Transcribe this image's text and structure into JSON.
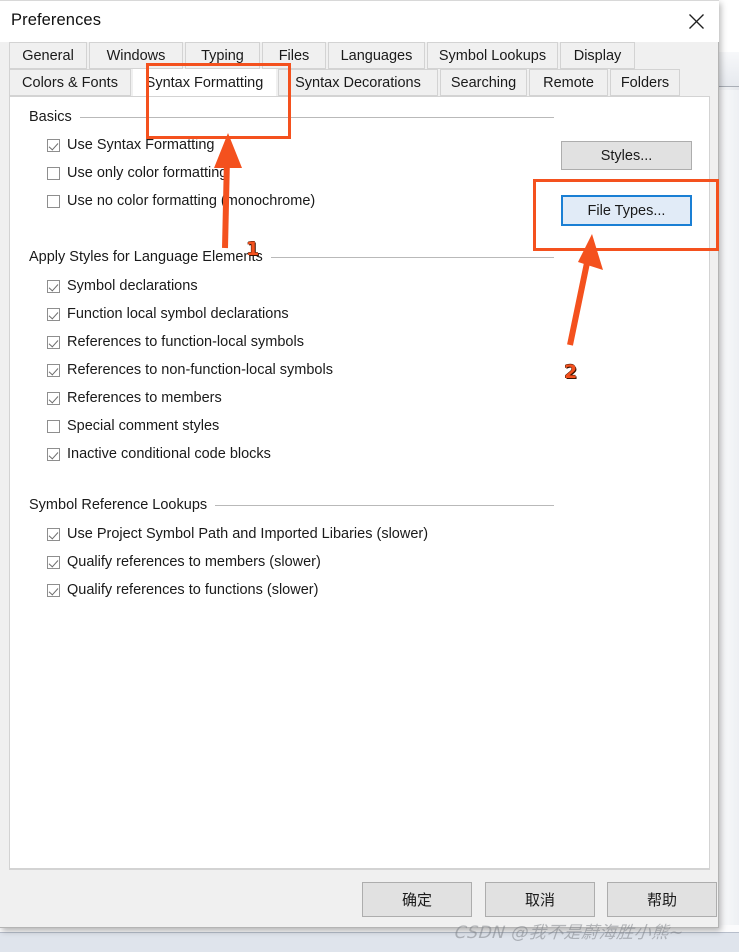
{
  "window": {
    "title": "Preferences",
    "close_icon": "close-icon"
  },
  "tabs": {
    "row1": [
      {
        "label": "General",
        "selected": false
      },
      {
        "label": "Windows",
        "selected": false
      },
      {
        "label": "Typing",
        "selected": false
      },
      {
        "label": "Files",
        "selected": false
      },
      {
        "label": "Languages",
        "selected": false
      },
      {
        "label": "Symbol Lookups",
        "selected": false
      },
      {
        "label": "Display",
        "selected": false
      }
    ],
    "row2": [
      {
        "label": "Colors & Fonts",
        "selected": false
      },
      {
        "label": "Syntax Formatting",
        "selected": true
      },
      {
        "label": "Syntax Decorations",
        "selected": false
      },
      {
        "label": "Searching",
        "selected": false
      },
      {
        "label": "Remote",
        "selected": false
      },
      {
        "label": "Folders",
        "selected": false
      }
    ]
  },
  "groups": [
    {
      "title": "Basics",
      "checkboxes": [
        {
          "label": "Use Syntax Formatting",
          "checked": true
        },
        {
          "label": "Use only color formatting",
          "checked": false
        },
        {
          "label": "Use no color formatting (monochrome)",
          "checked": false
        }
      ]
    },
    {
      "title": "Apply Styles for Language Elements",
      "checkboxes": [
        {
          "label": "Symbol declarations",
          "checked": true
        },
        {
          "label": "Function local symbol declarations",
          "checked": true
        },
        {
          "label": "References to function-local symbols",
          "checked": true
        },
        {
          "label": "References to non-function-local symbols",
          "checked": true
        },
        {
          "label": "References to members",
          "checked": true
        },
        {
          "label": "Special comment styles",
          "checked": false
        },
        {
          "label": "Inactive conditional code blocks",
          "checked": true
        }
      ]
    },
    {
      "title": "Symbol Reference Lookups",
      "checkboxes": [
        {
          "label": "Use Project Symbol Path and Imported Libaries (slower)",
          "checked": true
        },
        {
          "label": "Qualify references to members (slower)",
          "checked": true
        },
        {
          "label": "Qualify references to functions (slower)",
          "checked": true
        }
      ]
    }
  ],
  "side_buttons": [
    {
      "label": "Styles...",
      "focused": false
    },
    {
      "label": "File Types...",
      "focused": true
    }
  ],
  "footer_buttons": [
    {
      "label": "确定"
    },
    {
      "label": "取消"
    },
    {
      "label": "帮助"
    }
  ],
  "annotations": {
    "highlight_color": "#f4511e",
    "markers": [
      {
        "number": "1",
        "target": "syntax-formatting-tab"
      },
      {
        "number": "2",
        "target": "file-types-button"
      }
    ]
  },
  "watermark": {
    "text": "CSDN @我不是蔚海胜小熊~"
  }
}
